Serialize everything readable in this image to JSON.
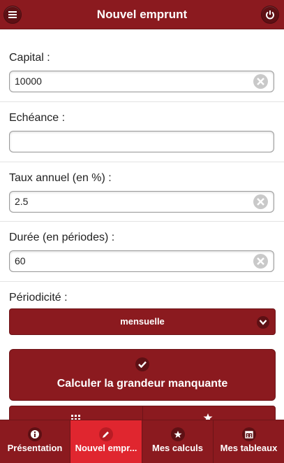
{
  "header": {
    "title": "Nouvel emprunt"
  },
  "fields": [
    {
      "label": "Capital :",
      "value": "10000",
      "has_clear": true
    },
    {
      "label": "Echéance :",
      "value": "",
      "has_clear": false
    },
    {
      "label": "Taux annuel (en %) :",
      "value": "2.5",
      "has_clear": true
    },
    {
      "label": "Durée (en périodes) :",
      "value": "60",
      "has_clear": true
    }
  ],
  "periodicity": {
    "label": "Périodicité :",
    "selected": "mensuelle"
  },
  "calc_button": {
    "label": "Calculer la grandeur manquante"
  },
  "tabs": [
    {
      "label": "Présentation",
      "icon": "info-icon",
      "active": false
    },
    {
      "label": "Nouvel empr...",
      "icon": "pencil-icon",
      "active": true
    },
    {
      "label": "Mes calculs",
      "icon": "star-icon",
      "active": false
    },
    {
      "label": "Mes tableaux",
      "icon": "calendar-icon",
      "active": false
    }
  ],
  "colors": {
    "primary": "#8b1a1f",
    "active_tab": "#e0262f"
  }
}
